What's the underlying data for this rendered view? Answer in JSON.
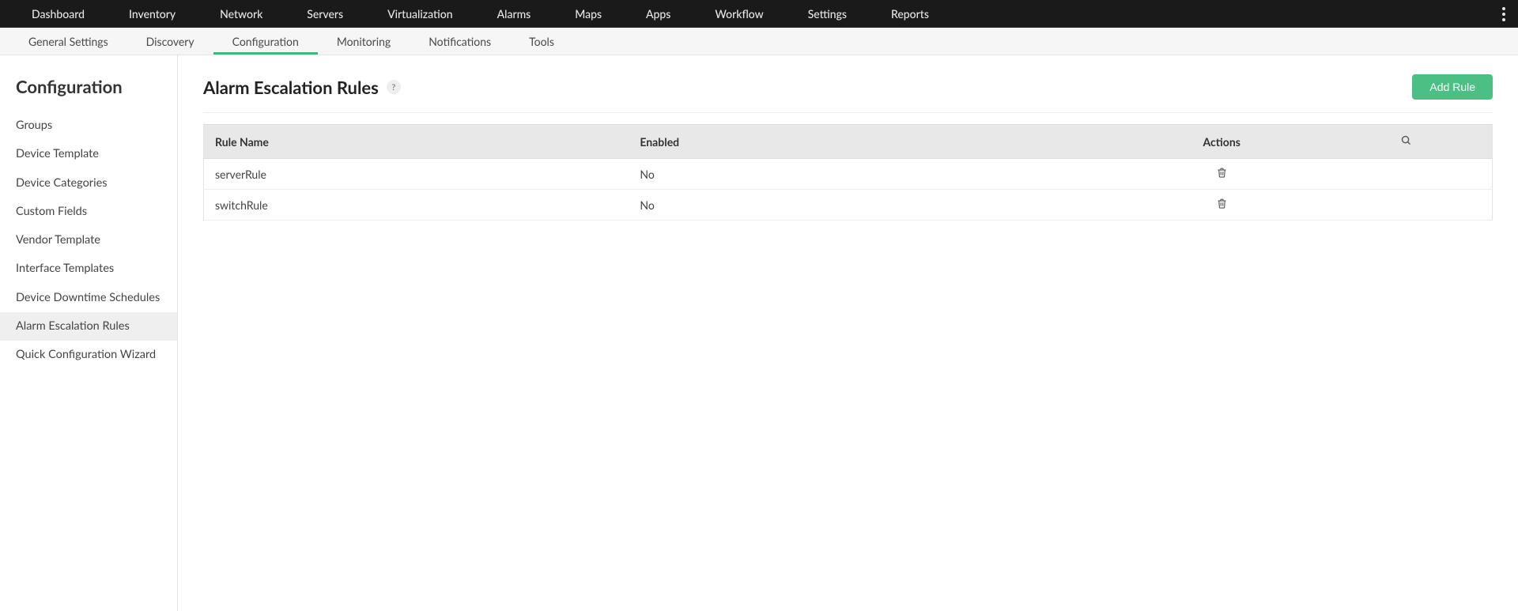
{
  "topnav": {
    "items": [
      {
        "label": "Dashboard"
      },
      {
        "label": "Inventory"
      },
      {
        "label": "Network"
      },
      {
        "label": "Servers"
      },
      {
        "label": "Virtualization"
      },
      {
        "label": "Alarms"
      },
      {
        "label": "Maps"
      },
      {
        "label": "Apps"
      },
      {
        "label": "Workflow"
      },
      {
        "label": "Settings"
      },
      {
        "label": "Reports"
      }
    ]
  },
  "subnav": {
    "items": [
      {
        "label": "General Settings"
      },
      {
        "label": "Discovery"
      },
      {
        "label": "Configuration",
        "active": true
      },
      {
        "label": "Monitoring"
      },
      {
        "label": "Notifications"
      },
      {
        "label": "Tools"
      }
    ]
  },
  "sidebar": {
    "title": "Configuration",
    "items": [
      {
        "label": "Groups"
      },
      {
        "label": "Device Template"
      },
      {
        "label": "Device Categories"
      },
      {
        "label": "Custom Fields"
      },
      {
        "label": "Vendor Template"
      },
      {
        "label": "Interface Templates"
      },
      {
        "label": "Device Downtime Schedules"
      },
      {
        "label": "Alarm Escalation Rules",
        "active": true
      },
      {
        "label": "Quick Configuration Wizard"
      }
    ]
  },
  "main": {
    "title": "Alarm Escalation Rules",
    "help_label": "?",
    "add_button": "Add Rule",
    "table": {
      "headers": {
        "name": "Rule Name",
        "enabled": "Enabled",
        "actions": "Actions"
      },
      "rows": [
        {
          "name": "serverRule",
          "enabled": "No"
        },
        {
          "name": "switchRule",
          "enabled": "No"
        }
      ]
    }
  }
}
